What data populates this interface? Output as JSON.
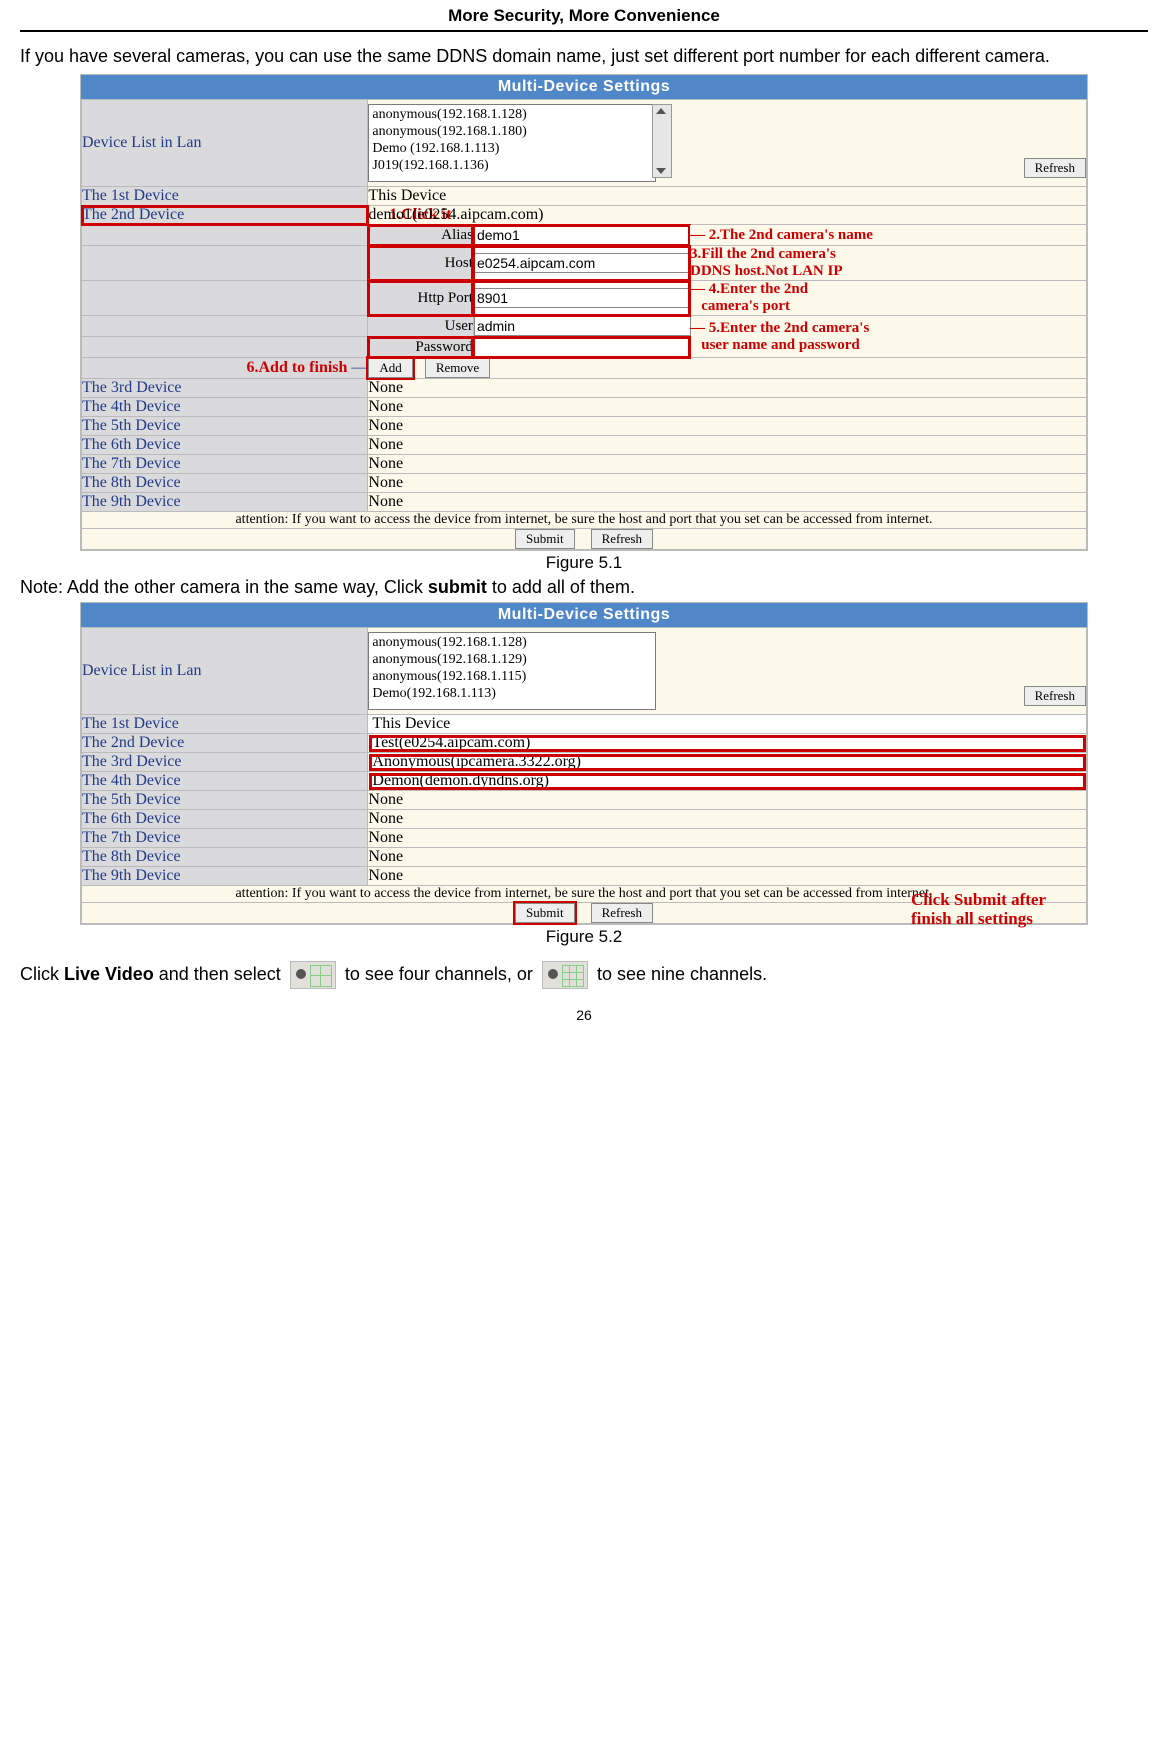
{
  "header": {
    "title": "More Security, More Convenience"
  },
  "intro": "If you have several cameras, you can use the same DDNS domain name, just set different port number for each different camera.",
  "panel1": {
    "title": "Multi-Device  Settings",
    "listLabel": "Device List in Lan",
    "listItems": [
      "anonymous(192.168.1.128)",
      "anonymous(192.168.1.180)",
      "Demo (192.168.1.113)",
      "J019(192.168.1.136)"
    ],
    "refresh": "Refresh",
    "dev1": {
      "label": "The 1st Device",
      "value": "This Device"
    },
    "dev2": {
      "label": "The 2nd Device",
      "value": "demo1(e0254.aipcam.com)"
    },
    "aliasLabel": "Alias",
    "aliasValue": "demo1",
    "hostLabel": "Host",
    "hostValue": "e0254.aipcam.com",
    "portLabel": "Http Port",
    "portValue": "8901",
    "userLabel": "User",
    "userValue": "admin",
    "pwLabel": "Password",
    "pwValue": "",
    "addBtn": "Add",
    "removeBtn": "Remove",
    "ann1": "1.Click it",
    "ann2": "2.The 2nd camera's name",
    "ann3a": "3.Fill the 2nd camera's",
    "ann3b": "DDNS host.Not LAN IP",
    "ann4a": "4.Enter the 2nd",
    "ann4b": "camera's port",
    "ann5a": "5.Enter the 2nd camera's",
    "ann5b": "user name and password",
    "ann6": "6.Add to finish",
    "dev3": {
      "label": "The 3rd Device",
      "value": "None"
    },
    "dev4": {
      "label": "The 4th Device",
      "value": "None"
    },
    "dev5": {
      "label": "The 5th Device",
      "value": "None"
    },
    "dev6": {
      "label": "The 6th Device",
      "value": "None"
    },
    "dev7": {
      "label": "The 7th Device",
      "value": "None"
    },
    "dev8": {
      "label": "The 8th Device",
      "value": "None"
    },
    "dev9": {
      "label": "The 9th Device",
      "value": "None"
    },
    "attention": "attention: If you want to access the device from internet, be sure the host and port that you set can be accessed from internet.",
    "submit": "Submit",
    "refreshBtn": "Refresh"
  },
  "fig1": "Figure 5.1",
  "note": {
    "pre": "Note: Add the other camera in the same way, Click ",
    "bold": "submit",
    "post": " to add all of them."
  },
  "panel2": {
    "title": "Multi-Device  Settings",
    "listLabel": "Device List in Lan",
    "listItems": [
      "anonymous(192.168.1.128)",
      "anonymous(192.168.1.129)",
      "anonymous(192.168.1.115)",
      "Demo(192.168.1.113)"
    ],
    "refresh": "Refresh",
    "dev1": {
      "label": "The 1st Device",
      "value": "This Device"
    },
    "dev2": {
      "label": "The 2nd Device",
      "value": "Test(e0254.aipcam.com)"
    },
    "dev3": {
      "label": "The 3rd Device",
      "value": "Anonymous(ipcamera.3322.org)"
    },
    "dev4": {
      "label": "The 4th Device",
      "value": "Demon(demon.dyndns.org)"
    },
    "dev5": {
      "label": "The 5th Device",
      "value": "None"
    },
    "dev6": {
      "label": "The 6th Device",
      "value": "None"
    },
    "dev7": {
      "label": "The 7th Device",
      "value": "None"
    },
    "dev8": {
      "label": "The 8th Device",
      "value": "None"
    },
    "dev9": {
      "label": "The 9th Device",
      "value": "None"
    },
    "attention": "attention: If you want to access the device from internet, be sure the host and port that you set can be accessed from internet.",
    "submit": "Submit",
    "refreshBtn": "Refresh",
    "annSubmitA": "Click Submit after",
    "annSubmitB": "finish all settings"
  },
  "fig2": "Figure 5.2",
  "final": {
    "pre": "Click ",
    "bold1": "Live Video",
    "mid1": " and then select ",
    "mid2": " to see four channels, or ",
    "post": " to see nine channels."
  },
  "pageNum": "26"
}
